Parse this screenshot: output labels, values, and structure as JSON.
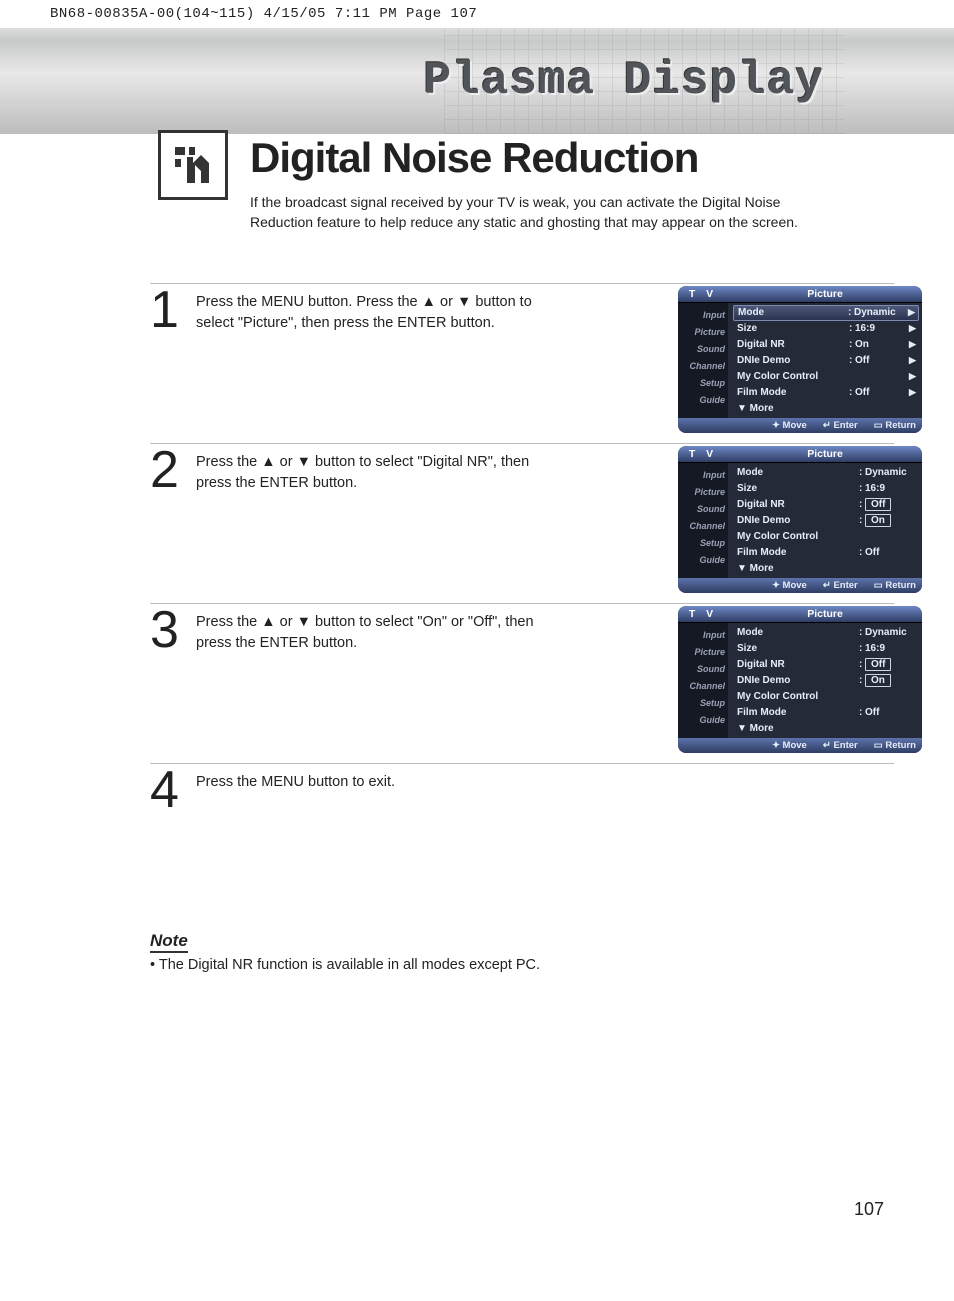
{
  "print_header": "BN68-00835A-00(104~115)  4/15/05  7:11 PM  Page 107",
  "banner_title": "Plasma Display",
  "page_title": "Digital Noise Reduction",
  "intro": "If the broadcast signal received by your TV is weak, you can activate the Digital Noise Reduction feature to help reduce any static and ghosting that may appear on the screen.",
  "steps": [
    {
      "n": "1",
      "text": "Press the MENU button. Press the ▲ or ▼ button to select \"Picture\", then press the ENTER button."
    },
    {
      "n": "2",
      "text": "Press the ▲ or ▼ button to select \"Digital NR\", then press the ENTER button."
    },
    {
      "n": "3",
      "text": "Press the ▲ or ▼ button to select \"On\" or \"Off\", then press the ENTER button."
    },
    {
      "n": "4",
      "text": "Press the MENU button to exit."
    }
  ],
  "osd_common": {
    "tv": "T V",
    "category": "Picture",
    "sidebar": [
      "Input",
      "Picture",
      "Sound",
      "Channel",
      "Setup",
      "Guide"
    ],
    "footer": {
      "move": "Move",
      "enter": "Enter",
      "return": "Return"
    },
    "more": "▼ More",
    "rows_base": [
      {
        "label": "Mode",
        "value": "Dynamic"
      },
      {
        "label": "Size",
        "value": "16:9"
      },
      {
        "label": "Digital NR",
        "value": "On"
      },
      {
        "label": "DNIe Demo",
        "value": "Off"
      },
      {
        "label": "My Color Control",
        "value": ""
      },
      {
        "label": "Film Mode",
        "value": "Off"
      }
    ]
  },
  "osd1": {
    "selected_row": 0,
    "show_arrows": true
  },
  "osd2": {
    "digital_nr_options": [
      "Off",
      "On"
    ],
    "digital_nr_selected": 0
  },
  "osd3": {
    "digital_nr_options": [
      "Off",
      "On"
    ],
    "digital_nr_selected": 1
  },
  "note": {
    "title": "Note",
    "body": "• The Digital NR function is available in all modes except PC."
  },
  "page_number": "107"
}
